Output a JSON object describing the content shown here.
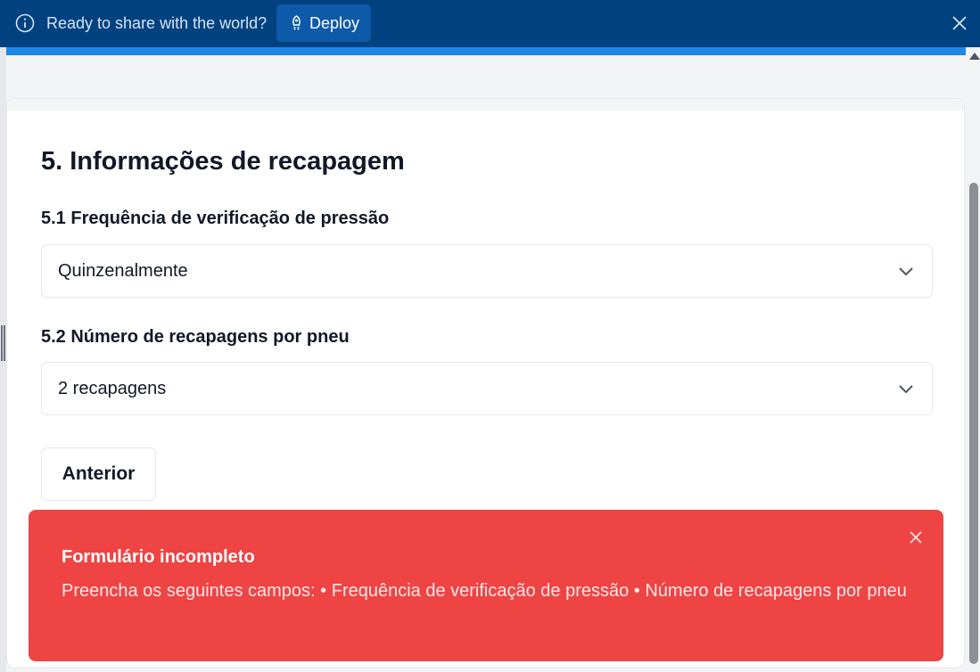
{
  "banner": {
    "info_icon": "info-circle-icon",
    "text": "Ready to share with the world?",
    "deploy_label": "Deploy",
    "deploy_icon": "rocket-icon",
    "close_icon": "close-icon"
  },
  "form": {
    "section_title": "5. Informações de recapagem",
    "fields": [
      {
        "label": "5.1 Frequência de verificação de pressão",
        "value": "Quinzenalmente"
      },
      {
        "label": "5.2 Número de recapagens por pneu",
        "value": "2 recapagens"
      }
    ],
    "previous_label": "Anterior"
  },
  "toast": {
    "title": "Formulário incompleto",
    "message": "Preencha os seguintes campos: • Frequência de verificação de pressão • Número de recapagens por pneu",
    "close_icon": "close-icon"
  },
  "colors": {
    "banner_bg": "#00417f",
    "accent": "#1e88e5",
    "toast_bg": "#ef4444"
  }
}
